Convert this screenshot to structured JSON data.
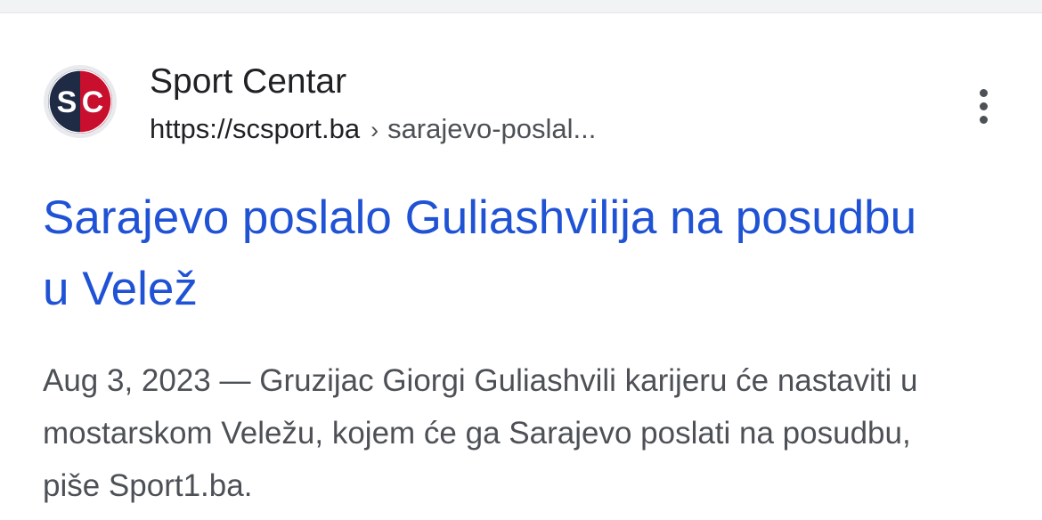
{
  "result": {
    "site_name": "Sport Centar",
    "url_domain": "https://scsport.ba",
    "url_separator": "›",
    "url_path": "sarajevo-poslal...",
    "title": "Sarajevo poslalo Guliashvilija na posudbu u Velež",
    "date": "Aug 3, 2023",
    "date_separator": "—",
    "snippet": "Gruzijac Giorgi Guliashvili karijeru će nastaviti u mostarskom Veležu, kojem će ga Sarajevo poslati na posudbu, piše Sport1.ba.",
    "favicon": {
      "icon": "sc-logo-icon",
      "letters": [
        "S",
        "C"
      ],
      "colors": {
        "ring": "#e8eaed",
        "dark": "#1f2a44",
        "red": "#c8102e",
        "white": "#ffffff"
      }
    },
    "more_icon": "more-vert-icon"
  },
  "colors": {
    "link": "#1f52d4",
    "text_primary": "#202124",
    "text_secondary": "#4d5156",
    "top_strip": "#f1f3f4"
  }
}
